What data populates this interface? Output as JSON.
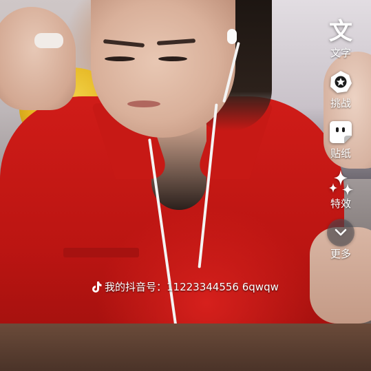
{
  "side_toolbar": {
    "items": [
      {
        "label": "文字",
        "glyph": "文",
        "icon": "text-icon"
      },
      {
        "label": "挑战",
        "icon": "challenge-icon"
      },
      {
        "label": "贴纸",
        "icon": "sticker-icon"
      },
      {
        "label": "特效",
        "icon": "sparkle-effects-icon"
      },
      {
        "label": "更多",
        "icon": "chevron-down-icon"
      }
    ]
  },
  "watermark": {
    "icon": "tiktok-logo-icon",
    "text": "我的抖音号：11223344556 6qwqw"
  },
  "colors": {
    "overlay_text": "#ffffff",
    "shirt_red": "#c71915",
    "more_button_bg": "rgba(80,80,88,0.55)"
  }
}
